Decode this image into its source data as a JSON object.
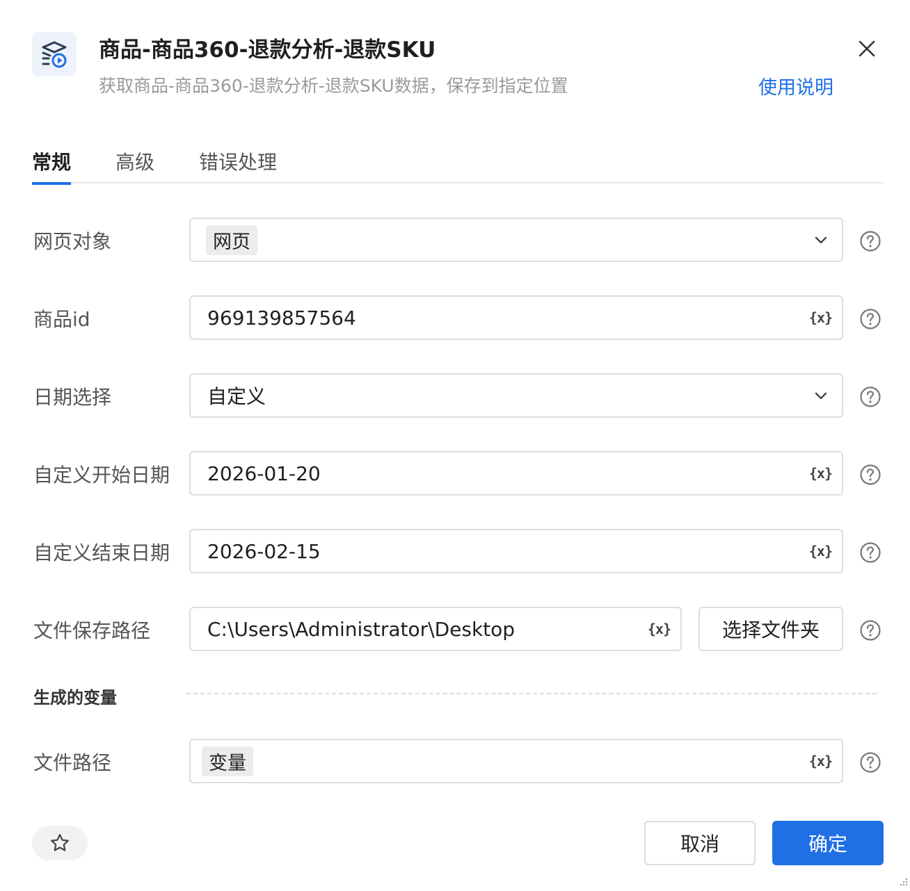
{
  "header": {
    "title": "商品-商品360-退款分析-退款SKU",
    "subtitle": "获取商品-商品360-退款分析-退款SKU数据，保存到指定位置",
    "help_link": "使用说明",
    "icon": "play-stack-icon",
    "accent_color": "#1f6fe5"
  },
  "tabs": [
    {
      "label": "常规",
      "active": true
    },
    {
      "label": "高级",
      "active": false
    },
    {
      "label": "错误处理",
      "active": false
    }
  ],
  "form": {
    "web_object": {
      "label": "网页对象",
      "value": "网页"
    },
    "product_id": {
      "label": "商品id",
      "value": "969139857564"
    },
    "date_select": {
      "label": "日期选择",
      "value": "自定义"
    },
    "start_date": {
      "label": "自定义开始日期",
      "value": "2026-01-20"
    },
    "end_date": {
      "label": "自定义结束日期",
      "value": "2026-02-15"
    },
    "save_path": {
      "label": "文件保存路径",
      "value": "C:\\Users\\Administrator\\Desktop",
      "pick_button": "选择文件夹"
    },
    "var_button": "{x}"
  },
  "output_section": {
    "title": "生成的变量",
    "file_path": {
      "label": "文件路径",
      "value": "变量"
    }
  },
  "footer": {
    "cancel": "取消",
    "confirm": "确定"
  }
}
